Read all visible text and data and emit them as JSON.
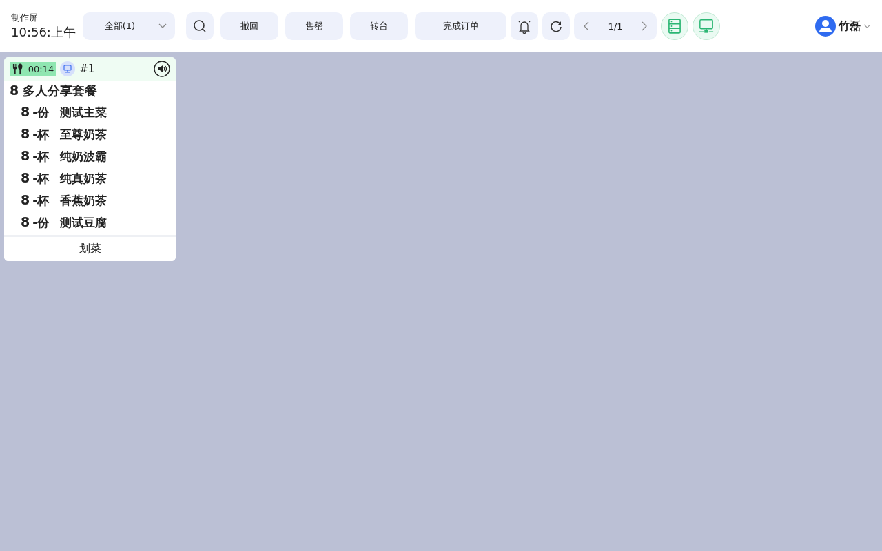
{
  "header": {
    "title": "制作屏",
    "time": "10:56:上午"
  },
  "filter": {
    "value": "全部(1)"
  },
  "actions": [
    "撤回",
    "售罄",
    "转台",
    "完成订单"
  ],
  "pager": {
    "text": "1/1"
  },
  "user": {
    "name": "竹磊"
  },
  "orders": [
    {
      "timer": "-00:14",
      "number": "#1",
      "title_qty": "8",
      "title": "多人分享套餐",
      "items": [
        {
          "qty": "8",
          "unit": "-份",
          "name": "测试主菜"
        },
        {
          "qty": "8",
          "unit": "-杯",
          "name": "至尊奶茶"
        },
        {
          "qty": "8",
          "unit": "-杯",
          "name": "纯奶波霸"
        },
        {
          "qty": "8",
          "unit": "-杯",
          "name": "纯真奶茶"
        },
        {
          "qty": "8",
          "unit": "-杯",
          "name": "香蕉奶茶"
        },
        {
          "qty": "8",
          "unit": "-份",
          "name": "测试豆腐"
        }
      ],
      "footer_button": "划菜"
    }
  ]
}
